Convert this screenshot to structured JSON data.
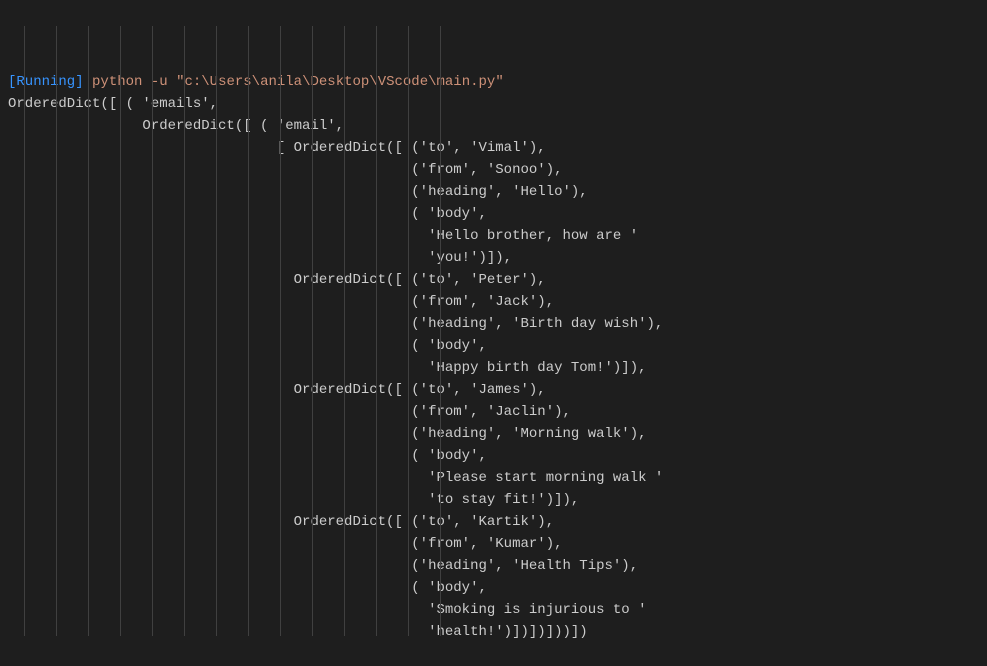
{
  "header": {
    "running_label": "[Running]",
    "command": "python -u",
    "path": "\"c:\\Users\\anila\\Desktop\\VScode\\main.py\""
  },
  "output": {
    "lines": [
      "OrderedDict([ ( 'emails',",
      "                OrderedDict([ ( 'email',",
      "                                [ OrderedDict([ ('to', 'Vimal'),",
      "                                                ('from', 'Sonoo'),",
      "                                                ('heading', 'Hello'),",
      "                                                ( 'body',",
      "                                                  'Hello brother, how are '",
      "                                                  'you!')]),",
      "                                  OrderedDict([ ('to', 'Peter'),",
      "                                                ('from', 'Jack'),",
      "                                                ('heading', 'Birth day wish'),",
      "                                                ( 'body',",
      "                                                  'Happy birth day Tom!')]),",
      "                                  OrderedDict([ ('to', 'James'),",
      "                                                ('from', 'Jaclin'),",
      "                                                ('heading', 'Morning walk'),",
      "                                                ( 'body',",
      "                                                  'Please start morning walk '",
      "                                                  'to stay fit!')]),",
      "                                  OrderedDict([ ('to', 'Kartik'),",
      "                                                ('from', 'Kumar'),",
      "                                                ('heading', 'Health Tips'),",
      "                                                ( 'body',",
      "                                                  'Smoking is injurious to '",
      "                                                  'health!')])])]))])"
    ]
  },
  "guides": {
    "positions": [
      16,
      48,
      80,
      112,
      144,
      176,
      208,
      240,
      272,
      304,
      336,
      368,
      400,
      432
    ]
  }
}
